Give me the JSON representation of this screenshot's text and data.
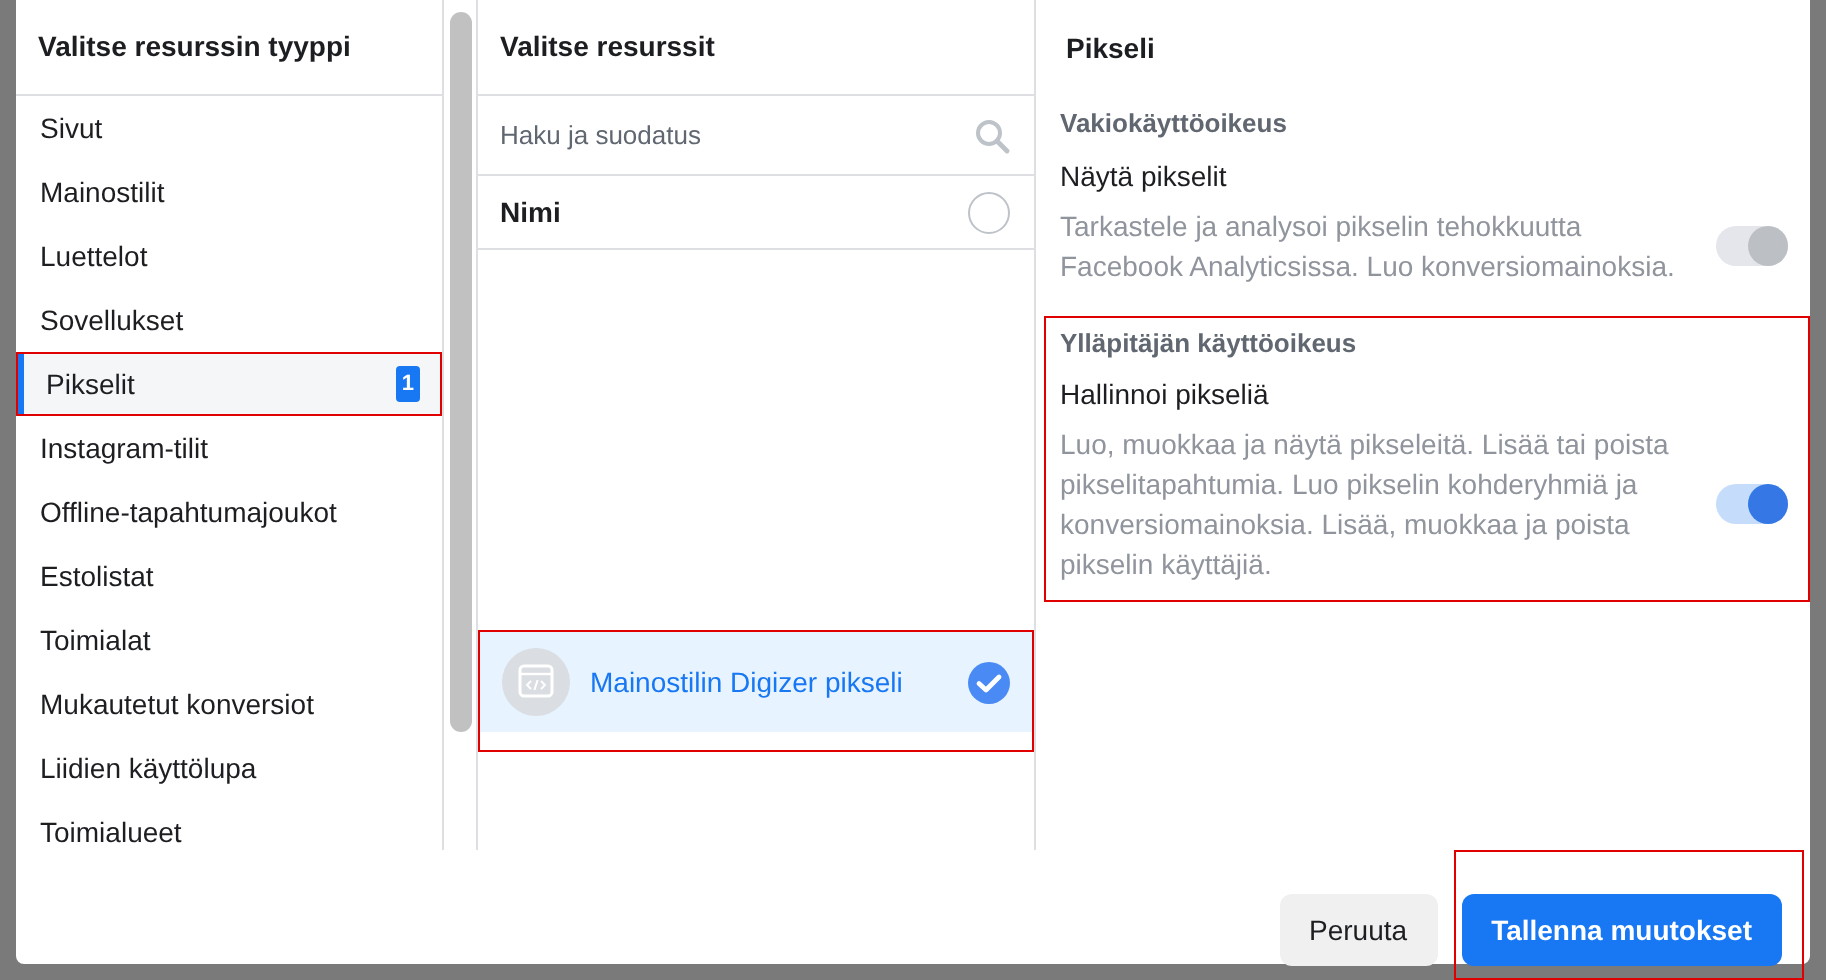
{
  "left_panel": {
    "title": "Valitse resurssin tyyppi",
    "items": [
      {
        "label": "Sivut",
        "selected": false,
        "highlighted": false
      },
      {
        "label": "Mainostilit",
        "selected": false,
        "highlighted": false
      },
      {
        "label": "Luettelot",
        "selected": false,
        "highlighted": false
      },
      {
        "label": "Sovellukset",
        "selected": false,
        "highlighted": false
      },
      {
        "label": "Pikselit",
        "selected": true,
        "highlighted": true,
        "badge": "1"
      },
      {
        "label": "Instagram-tilit",
        "selected": false,
        "highlighted": false
      },
      {
        "label": "Offline-tapahtumajoukot",
        "selected": false,
        "highlighted": false
      },
      {
        "label": "Estolistat",
        "selected": false,
        "highlighted": false
      },
      {
        "label": "Toimialat",
        "selected": false,
        "highlighted": false
      },
      {
        "label": "Mukautetut konversiot",
        "selected": false,
        "highlighted": false
      },
      {
        "label": "Liidien käyttölupa",
        "selected": false,
        "highlighted": false
      },
      {
        "label": "Toimialueet",
        "selected": false,
        "highlighted": false
      }
    ]
  },
  "middle_panel": {
    "title": "Valitse resurssit",
    "search": {
      "placeholder": "Haku ja suodatus"
    },
    "column_header": "Nimi",
    "select_all_checked": false,
    "resources": [
      {
        "name": "Mainostilin Digizer pikseli",
        "selected": true,
        "highlighted": true
      }
    ]
  },
  "right_panel": {
    "title": "Pikseli",
    "sections": [
      {
        "heading": "Vakiokäyttöoikeus",
        "highlighted": false,
        "permission": {
          "name": "Näytä pikselit",
          "description": "Tarkastele ja analysoi pikselin tehokkuutta Facebook Analyticsissa. Luo konversiomainoksia.",
          "on": true,
          "disabled": true
        }
      },
      {
        "heading": "Ylläpitäjän käyttöoikeus",
        "highlighted": true,
        "permission": {
          "name": "Hallinnoi pikseliä",
          "description": "Luo, muokkaa ja näytä pikseleitä. Lisää tai poista pikselitapahtumia. Luo pikselin kohderyhmiä ja konversiomainoksia. Lisää, muokkaa ja poista pikselin käyttäjiä.",
          "on": true,
          "disabled": false
        }
      }
    ]
  },
  "footer": {
    "buttons": [
      {
        "label": "Peruuta",
        "kind": "secondary",
        "highlighted": false
      },
      {
        "label": "Tallenna muutokset",
        "kind": "primary",
        "highlighted": true
      }
    ]
  }
}
